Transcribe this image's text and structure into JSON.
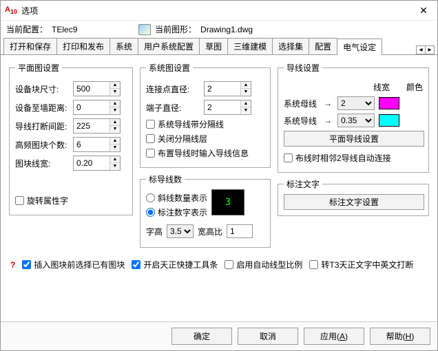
{
  "window": {
    "title": "选项"
  },
  "header": {
    "profile_label": "当前配置：",
    "profile_value": "TElec9",
    "drawing_label": "当前图形：",
    "drawing_value": "Drawing1.dwg"
  },
  "tabs": [
    "打开和保存",
    "打印和发布",
    "系统",
    "用户系统配置",
    "草图",
    "三维建模",
    "选择集",
    "配置",
    "电气设定"
  ],
  "plan": {
    "legend": "平面图设置",
    "block_size_label": "设备块尺寸:",
    "block_size": "500",
    "wall_dist_label": "设备至墙距离:",
    "wall_dist": "0",
    "break_gap_label": "导线打断间距:",
    "break_gap": "225",
    "hf_count_label": "高频图块个数:",
    "hf_count": "6",
    "block_lw_label": "图块线宽:",
    "block_lw": "0.20",
    "rotate_attr_label": "旋转属性字"
  },
  "system": {
    "legend": "系统图设置",
    "conn_dia_label": "连接点直径:",
    "conn_dia": "2",
    "term_dia_label": "端子直径:",
    "term_dia": "2",
    "wire_sep_label": "系统导线带分隔线",
    "close_layer_label": "关闭分隔线层",
    "wire_info_label": "布置导线时输入导线信息"
  },
  "wirecount": {
    "legend": "标导线数",
    "slash_label": "斜线数量表示",
    "digit_label": "标注数字表示",
    "preview": "3",
    "font_h_label": "字高",
    "font_h": "3.5",
    "ratio_label": "宽高比",
    "ratio": "1"
  },
  "wire": {
    "legend": "导线设置",
    "lw_header": "线宽",
    "color_header": "颜色",
    "busbar_label": "系统母线",
    "busbar_lw": "2",
    "busbar_color": "#ff00ff",
    "syswire_label": "系统导线",
    "syswire_lw": "0.35",
    "syswire_color": "#00ffff",
    "plan_btn": "平面导线设置",
    "auto_connect_label": "布线时相邻2导线自动连接"
  },
  "labeltext": {
    "legend": "标注文字",
    "btn": "标注文字设置"
  },
  "bottom": {
    "preselect": "插入图块前选择已有图块",
    "toolbar": "开启天正快捷工具条",
    "autoscale": "启用自动线型比例",
    "t3break": "转T3天正文字中英文打断"
  },
  "footer": {
    "ok": "确定",
    "cancel": "取消",
    "apply": "应用",
    "apply_key": "A",
    "help": "帮助",
    "help_key": "H"
  }
}
